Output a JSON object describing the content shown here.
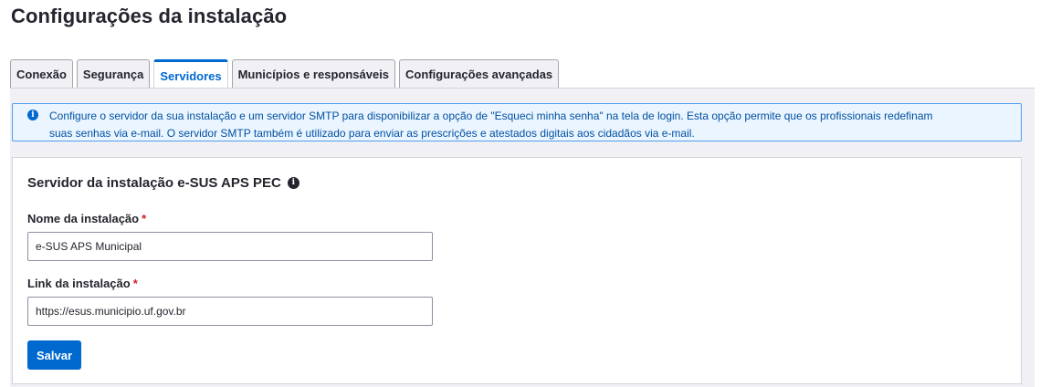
{
  "page": {
    "title": "Configurações da instalação"
  },
  "tabs": [
    {
      "label": "Conexão",
      "active": false
    },
    {
      "label": "Segurança",
      "active": false
    },
    {
      "label": "Servidores",
      "active": true
    },
    {
      "label": "Municípios e responsáveis",
      "active": false
    },
    {
      "label": "Configurações avançadas",
      "active": false
    }
  ],
  "alert": {
    "icon": "info-icon",
    "line1": "Configure o servidor da sua instalação e um servidor SMTP para disponibilizar a opção de \"Esqueci minha senha\" na tela de login. Esta opção permite que os profissionais redefinam",
    "line2": "suas senhas via e-mail. O servidor SMTP também é utilizado para enviar as prescrições e atestados digitais aos cidadãos via e-mail."
  },
  "server_section": {
    "title": "Servidor da instalação e-SUS APS PEC",
    "help_icon": "help-icon",
    "name_field": {
      "label": "Nome da instalação",
      "required_mark": "*",
      "value": "e-SUS APS Municipal"
    },
    "link_field": {
      "label": "Link da instalação",
      "required_mark": "*",
      "value": "https://esus.municipio.uf.gov.br"
    },
    "save_label": "Salvar"
  },
  "colors": {
    "primary": "#0069d0",
    "alert_bg": "#ebf5ff",
    "alert_border": "#4e9ef0",
    "required": "#d01e29"
  }
}
